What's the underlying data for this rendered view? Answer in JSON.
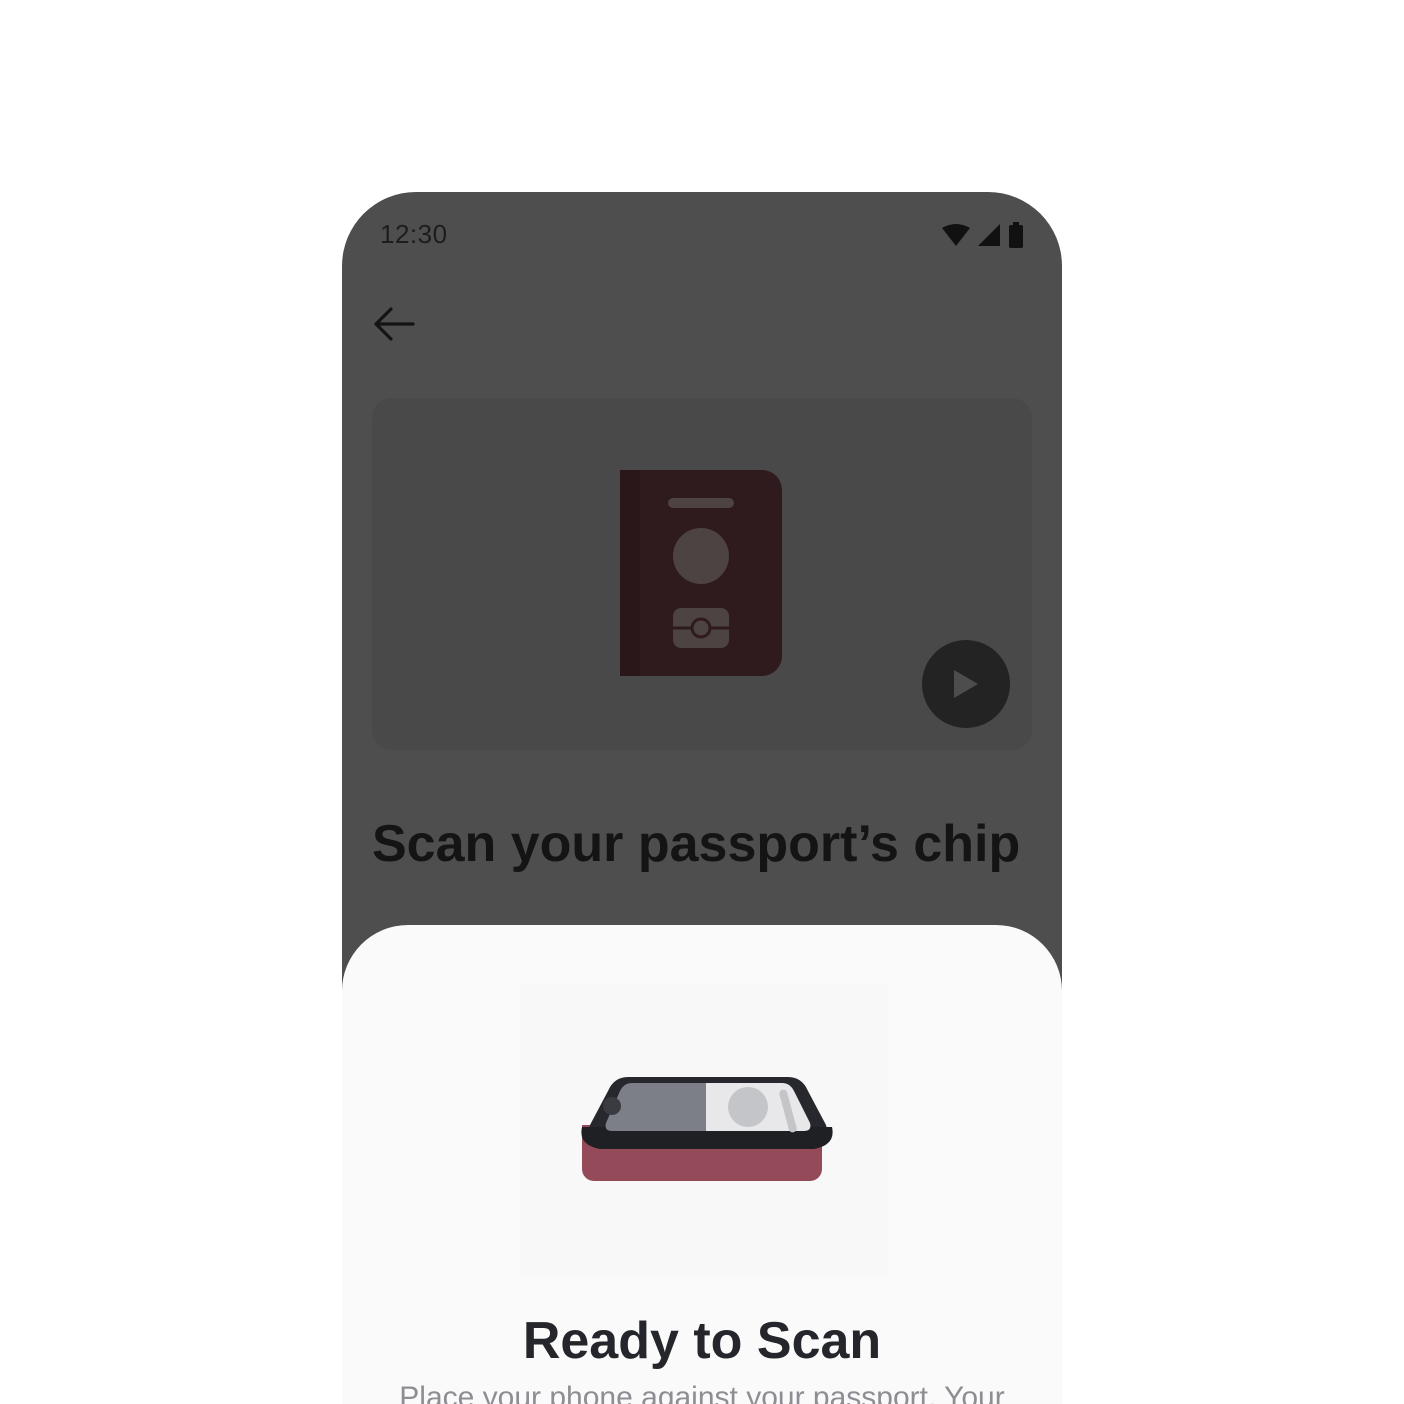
{
  "status_bar": {
    "time": "12:30",
    "icons": [
      "wifi-icon",
      "cellular-signal-icon",
      "battery-icon"
    ]
  },
  "toolbar": {
    "back_icon": "arrow-left-icon"
  },
  "media": {
    "illustration": "passport-icon",
    "play_icon": "play-icon"
  },
  "page": {
    "title": "Scan your passport’s chip"
  },
  "sheet": {
    "illustration": "phone-on-passport-icon",
    "title": "Ready to Scan",
    "body": "Place your phone against your passport. Your"
  },
  "colors": {
    "scrim_background": "#4e4e4e",
    "sheet_background": "#fafafa",
    "passport_dark": "#2f1b1e",
    "passport_accent": "#954a5a",
    "title_text": "#25262b"
  }
}
